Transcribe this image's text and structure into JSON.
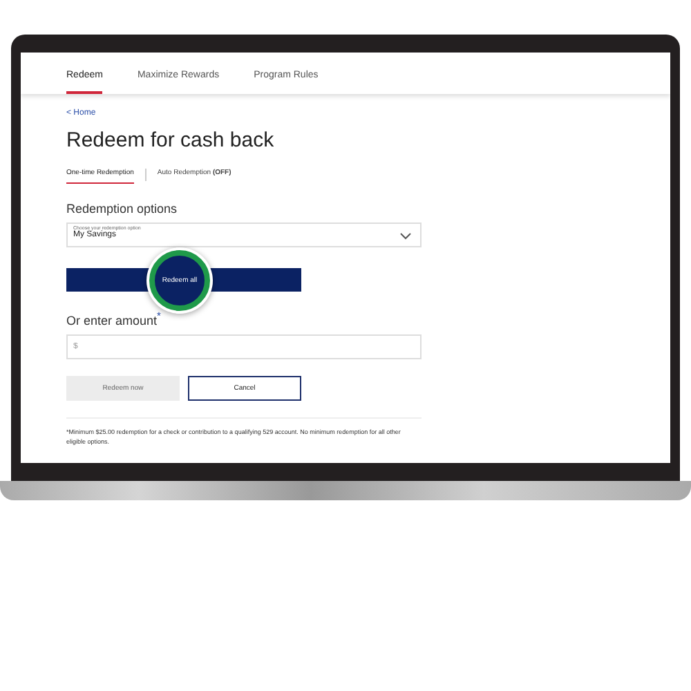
{
  "nav_tabs": [
    {
      "label": "Redeem",
      "selected": true
    },
    {
      "label": "Maximize Rewards",
      "selected": false
    },
    {
      "label": "Program Rules",
      "selected": false
    }
  ],
  "back_link": "< Home",
  "title": "Redeem for cash back",
  "sub_tabs": [
    {
      "label": "One-time Redemption",
      "selected": true
    },
    {
      "label": "Auto Redemption **(OFF)**",
      "selected": false
    }
  ],
  "section_title": "Redemption options",
  "select": {
    "label": "Choose your redemption option",
    "value": "My Savings"
  },
  "redeem_all_button": "Redeem all",
  "amount_title": "Or enter amount$^{*}$",
  "amount_input": {
    "placeholder": "$"
  },
  "buttons": [
    {
      "label": "Redeem now",
      "disabled": true
    },
    {
      "label": "Cancel",
      "disabled": false
    }
  ],
  "footnote": "*Minimum $25.00 redemption for a check or contribution to a qualifying 529 account. No minimum redemption for all other eligible options."
}
